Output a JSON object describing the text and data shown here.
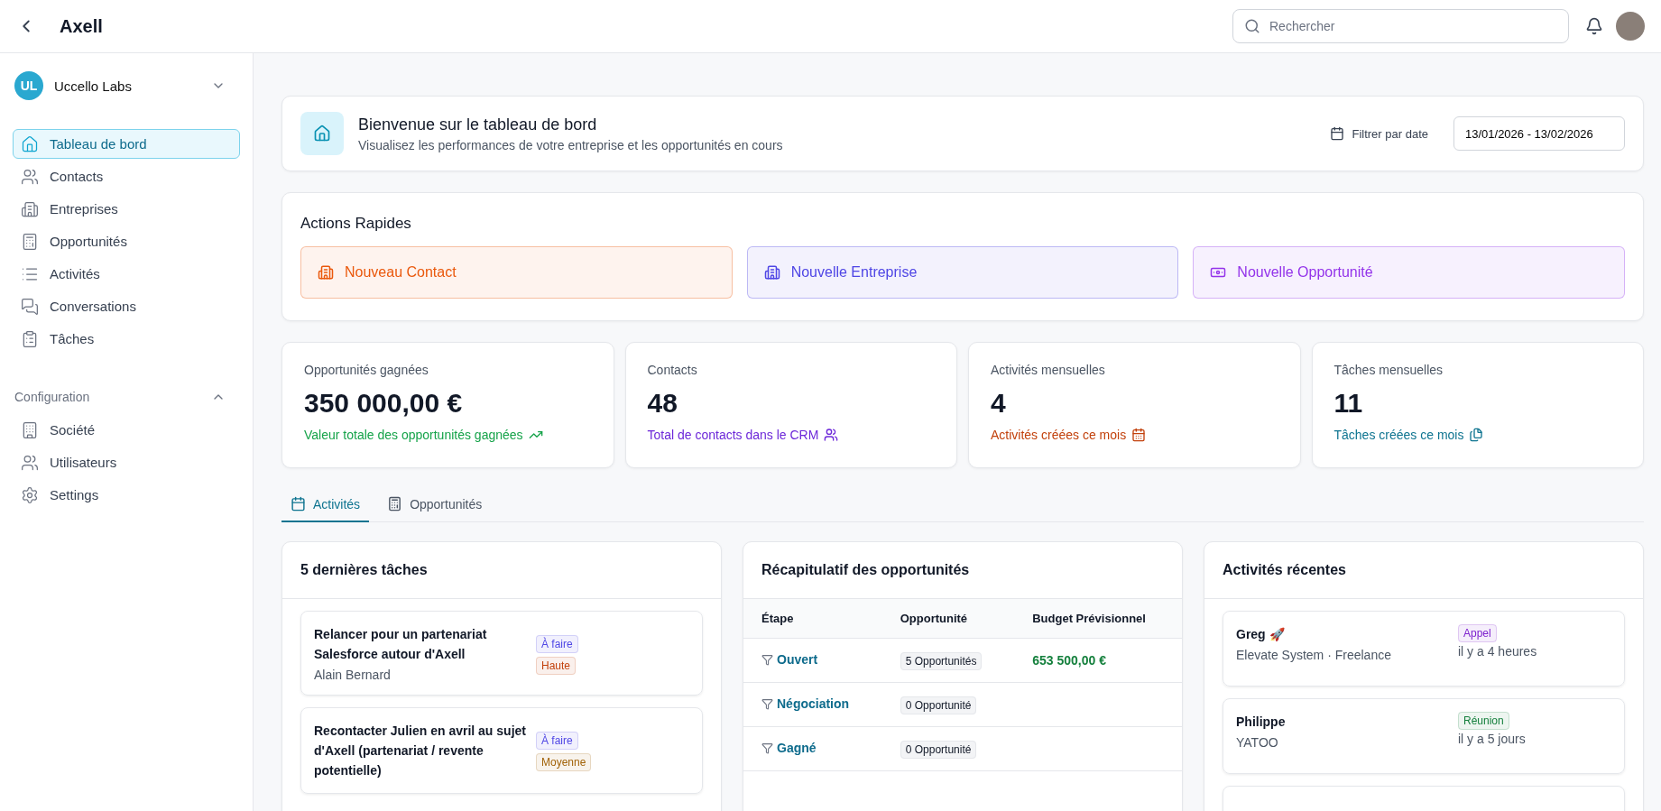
{
  "topbar": {
    "title": "Axell",
    "search": {
      "placeholder": "Rechercher"
    }
  },
  "sidebar": {
    "org": {
      "initials": "UL",
      "name": "Uccello Labs",
      "expanded": false
    },
    "items": [
      {
        "label": "Tableau de bord",
        "selected": true
      },
      {
        "label": "Contacts",
        "selected": false
      },
      {
        "label": "Entreprises",
        "selected": false
      },
      {
        "label": "Opportunités",
        "selected": false
      },
      {
        "label": "Activités",
        "selected": false
      },
      {
        "label": "Conversations",
        "selected": false
      },
      {
        "label": "Tâches",
        "selected": false
      }
    ],
    "config": {
      "label": "Configuration",
      "expanded": true,
      "items": [
        {
          "label": "Société",
          "selected": false
        },
        {
          "label": "Utilisateurs",
          "selected": false
        },
        {
          "label": "Settings",
          "selected": false
        }
      ]
    }
  },
  "header": {
    "title": "Bienvenue sur le tableau de bord",
    "subtitle": "Visualisez les performances de votre entreprise et les opportunités en cours",
    "filter_label": "Filtrer par date",
    "date_range": "13/01/2026 - 13/02/2026"
  },
  "quick_actions": {
    "title": "Actions Rapides",
    "items": [
      {
        "label": "Nouveau Contact",
        "color": "#ea580c"
      },
      {
        "label": "Nouvelle Entreprise",
        "color": "#4f46e5"
      },
      {
        "label": "Nouvelle Opportunité",
        "color": "#9333ea"
      }
    ]
  },
  "stats": [
    {
      "label": "Opportunités gagnées",
      "value": "350 000,00 €",
      "note": "Valeur totale des opportunités gagnées",
      "color": "#16a34a"
    },
    {
      "label": "Contacts",
      "value": "48",
      "note": "Total de contacts dans le CRM",
      "color": "#6d28d9"
    },
    {
      "label": "Activités mensuelles",
      "value": "4",
      "note": "Activités créées ce mois",
      "color": "#c2410c"
    },
    {
      "label": "Tâches mensuelles",
      "value": "11",
      "note": "Tâches créées ce mois",
      "color": "#0e7490"
    }
  ],
  "tabs": [
    {
      "label": "Activités",
      "selected": true
    },
    {
      "label": "Opportunités",
      "selected": false
    }
  ],
  "tasks": {
    "title": "5 dernières tâches",
    "items": [
      {
        "title": "Relancer pour un partenariat Salesforce autour d'Axell",
        "person": "Alain Bernard",
        "badges": [
          {
            "text": "À faire",
            "color": "#4f46e5"
          },
          {
            "text": "Haute",
            "color": "#c2410c"
          }
        ]
      },
      {
        "title": "Recontacter Julien en avril au sujet d'Axell (partenariat / revente potentielle)",
        "badges": [
          {
            "text": "À faire",
            "color": "#4f46e5"
          },
          {
            "text": "Moyenne",
            "color": "#a16207"
          }
        ]
      }
    ]
  },
  "opportunities": {
    "title": "Récapitulatif des opportunités",
    "columns": [
      "Étape",
      "Opportunité",
      "Budget Prévisionnel"
    ],
    "rows": [
      {
        "stage": "Ouvert",
        "count": "5 Opportunités",
        "budget": "653 500,00 €"
      },
      {
        "stage": "Négociation",
        "count": "0 Opportunité"
      },
      {
        "stage": "Gagné",
        "count": "0 Opportunité"
      }
    ]
  },
  "recent": {
    "title": "Activités récentes",
    "items": [
      {
        "name": "Greg 🚀",
        "company": "Elevate System · Freelance",
        "type": "Appel",
        "color": "#7e22ce",
        "time": "il y a 4 heures"
      },
      {
        "name": "Philippe",
        "company": "YATOO",
        "type": "Réunion",
        "color": "#15803d",
        "time": "il y a 5 jours"
      }
    ]
  }
}
